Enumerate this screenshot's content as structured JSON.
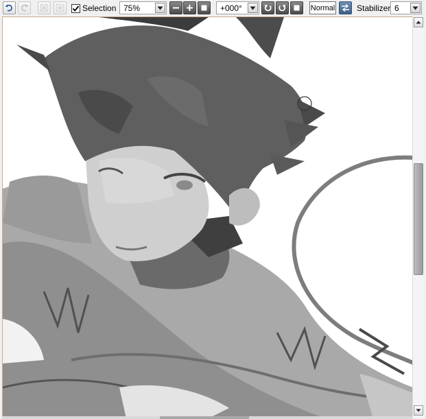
{
  "toolbar": {
    "undo_icon": "undo-icon",
    "redo_icon": "redo-icon",
    "selection_label": "Selection",
    "selection_checked": true,
    "zoom_value": "75%",
    "rotation_value": "+000°",
    "blend_mode": "Normal",
    "stabilizer_label": "Stabilizer",
    "stabilizer_value": "6"
  },
  "colors": {
    "toolbar_bg": "#f0f0f0",
    "canvas_border": "#c8a98a",
    "scroll_thumb": "#a8a8a8"
  },
  "canvas": {
    "content": "grayscale illustration of a character with spiky hair",
    "brush_cursor": "circle-cursor"
  }
}
